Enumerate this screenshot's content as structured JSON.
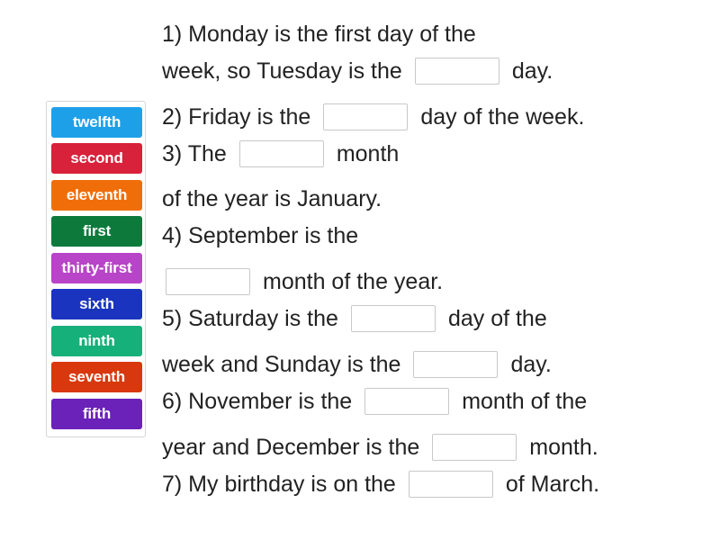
{
  "tiles": [
    {
      "label": "twelfth",
      "color": "#1ea0e8"
    },
    {
      "label": "second",
      "color": "#d8213a"
    },
    {
      "label": "eleventh",
      "color": "#f06e0a"
    },
    {
      "label": "first",
      "color": "#0d7a3c"
    },
    {
      "label": "thirty-first",
      "color": "#b844c8"
    },
    {
      "label": "sixth",
      "color": "#1a34c0"
    },
    {
      "label": "ninth",
      "color": "#16b07a"
    },
    {
      "label": "seventh",
      "color": "#d9380e"
    },
    {
      "label": "fifth",
      "color": "#6a22b8"
    }
  ],
  "lines": [
    {
      "a": "1) Monday is the first day of the"
    },
    {
      "a": "week, so Tuesday is the",
      "b": "day."
    },
    {
      "a": "2) Friday is the",
      "b": "day of the week."
    },
    {
      "a": "3) The",
      "b": "month"
    },
    {
      "a": "of the year is January."
    },
    {
      "a": "4) September is the"
    },
    {
      "b": "month of the year."
    },
    {
      "a": "5) Saturday is the",
      "b": "day of the"
    },
    {
      "a": "week and Sunday is the",
      "b": "day."
    },
    {
      "a": "6) November is the",
      "b": "month of the"
    },
    {
      "a": "year and December is the",
      "b": "month."
    },
    {
      "a": "7) My birthday is on the",
      "b": "of March."
    }
  ]
}
